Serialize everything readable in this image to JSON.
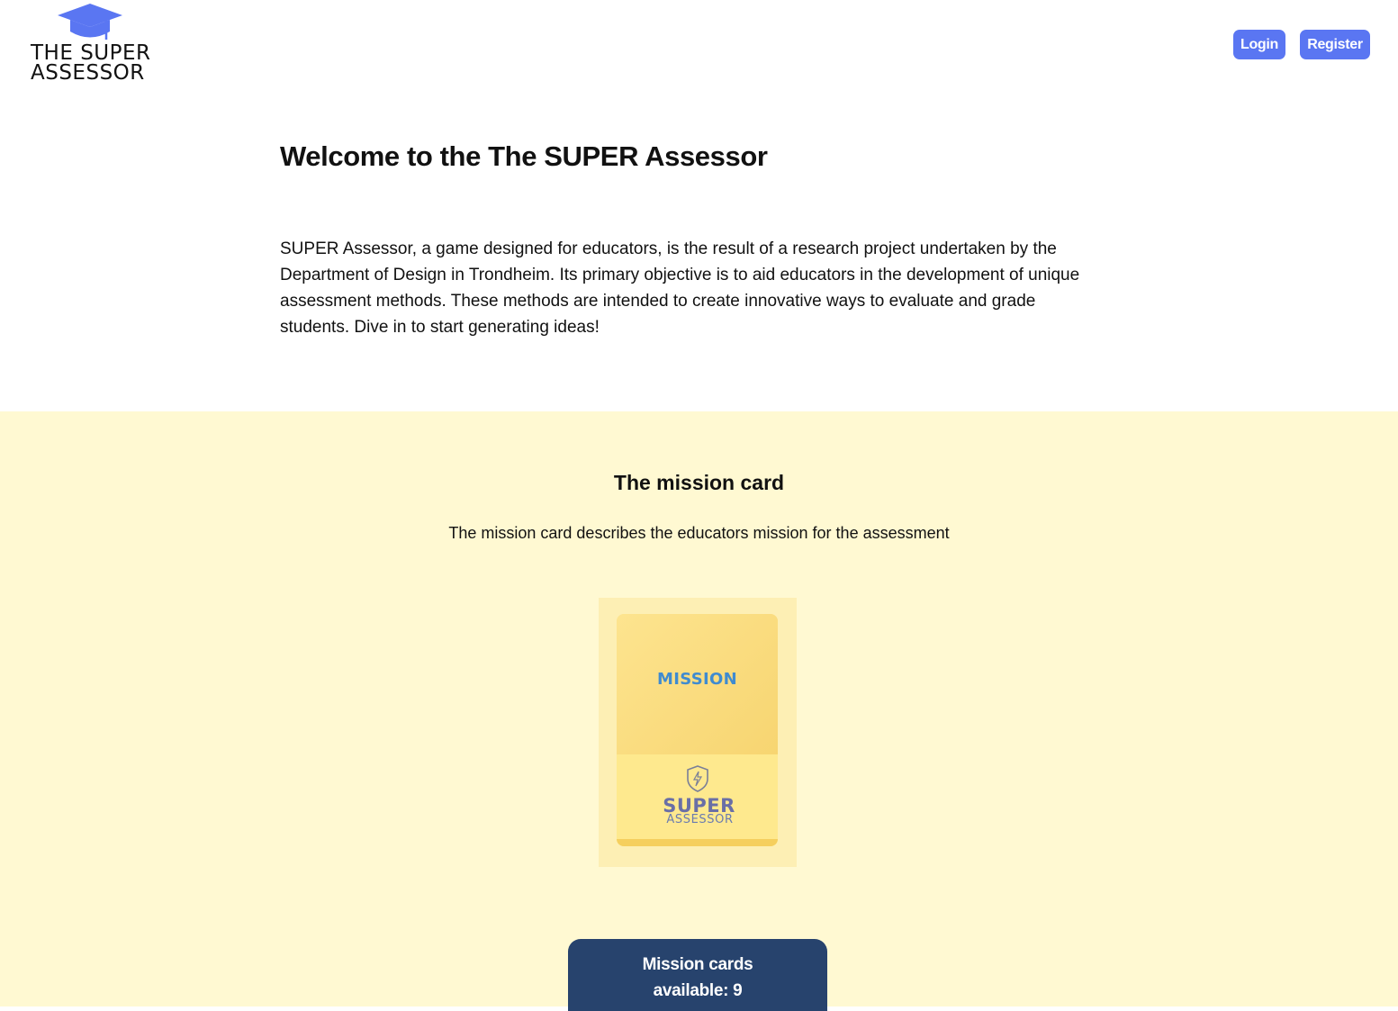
{
  "header": {
    "logo_line1": "THE SUPER",
    "logo_line2": "ASSESSOR",
    "logo_icon": "graduation-cap-icon",
    "login_label": "Login",
    "register_label": "Register",
    "button_color": "#5a76f2"
  },
  "intro": {
    "title": "Welcome to the The SUPER Assessor",
    "description": "SUPER Assessor, a game designed for educators, is the result of a research project undertaken by the Department of Design in Trondheim. Its primary objective is to aid educators in the development of unique assessment methods. These methods are intended to create innovative ways to evaluate and grade students. Dive in to start generating ideas!"
  },
  "mission": {
    "title": "The mission card",
    "description": "The mission card describes the educators mission for the assessment",
    "background_color": "#fff9d2",
    "card": {
      "label": "MISSION",
      "brand_big": "SUPER",
      "brand_small": "ASSESSOR",
      "icon": "shield-bolt-icon"
    },
    "count_line1": "Mission cards",
    "count_line2": "available: 9",
    "count_box_color": "#27436d"
  }
}
